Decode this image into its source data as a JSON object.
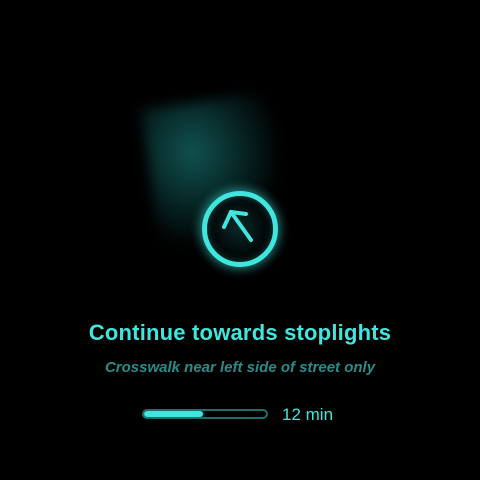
{
  "navigation": {
    "instruction": "Continue towards stoplights",
    "detail": "Crosswalk near left side of street only",
    "eta_label": "12 min",
    "progress_fraction": 0.48,
    "direction_icon": "arrow-up-left-icon"
  },
  "colors": {
    "background": "#000000",
    "accent": "#3fe6dd",
    "accent_muted": "#2a8c88"
  }
}
